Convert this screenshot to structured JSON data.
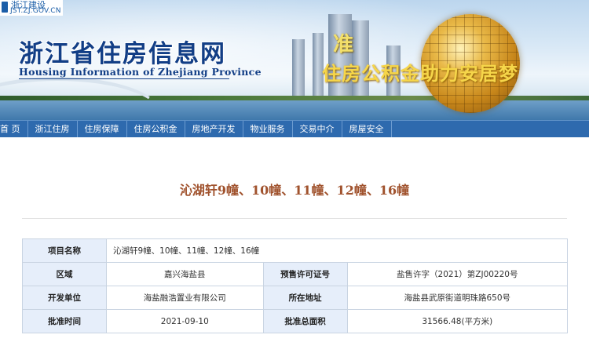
{
  "header": {
    "logo_cn": "浙江建设",
    "logo_url": "JST.ZJ.GOV.CN",
    "site_title": "浙江省住房信息网",
    "site_subtitle": "Housing Information of Zhejiang Province",
    "slogan_line1": "准",
    "slogan_line2": "住房公积金助力安居梦"
  },
  "nav": {
    "items": [
      {
        "label": "首 页"
      },
      {
        "label": "浙江住房"
      },
      {
        "label": "住房保障"
      },
      {
        "label": "住房公积金"
      },
      {
        "label": "房地产开发"
      },
      {
        "label": "物业服务"
      },
      {
        "label": "交易中介"
      },
      {
        "label": "房屋安全"
      }
    ]
  },
  "main": {
    "title": "沁湖轩9幢、10幢、11幢、12幢、16幢",
    "rows": [
      {
        "label1": "项目名称",
        "value1": "沁湖轩9幢、10幢、11幢、12幢、16幢"
      },
      {
        "label1": "区域",
        "value1": "嘉兴海盐县",
        "label2": "预售许可证号",
        "value2": "盐售许字（2021）第ZJ00220号"
      },
      {
        "label1": "开发单位",
        "value1": "海盐融浩置业有限公司",
        "label2": "所在地址",
        "value2": "海盐县武原街道明珠路650号"
      },
      {
        "label1": "批准时间",
        "value1": "2021-09-10",
        "label2": "批准总面积",
        "value2": "31566.48(平方米)"
      }
    ]
  },
  "colors": {
    "nav_bg": "#2e6aae",
    "title_color": "#a0522d",
    "label_bg": "#e6eefa",
    "brand_blue": "#123e86"
  }
}
